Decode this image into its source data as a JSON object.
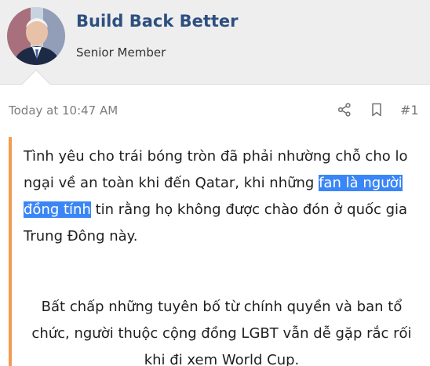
{
  "user": {
    "name": "Build Back Better",
    "title": "Senior Member"
  },
  "post": {
    "time": "Today at 10:47 AM",
    "number": "#1",
    "actions": [
      "share-icon",
      "bookmark-icon"
    ]
  },
  "message": {
    "p1_before": "Tình yêu cho trái bóng tròn đã phải nhường chỗ cho lo ngại về an toàn khi đến Qatar, khi những ",
    "p1_highlight": "fan là người đồng tính",
    "p1_after": " tin rằng họ không được chào đón ở quốc gia Trung Đông này.",
    "p2": "Bất chấp những tuyên bố từ chính quyền và ban tổ chức, người thuộc cộng đồng LGBT vẫn dễ gặp rắc rối khi đi xem World Cup."
  },
  "colors": {
    "name": "#2d4f80",
    "quote_bar": "#f39b4f",
    "selection": "#3b86f6"
  }
}
